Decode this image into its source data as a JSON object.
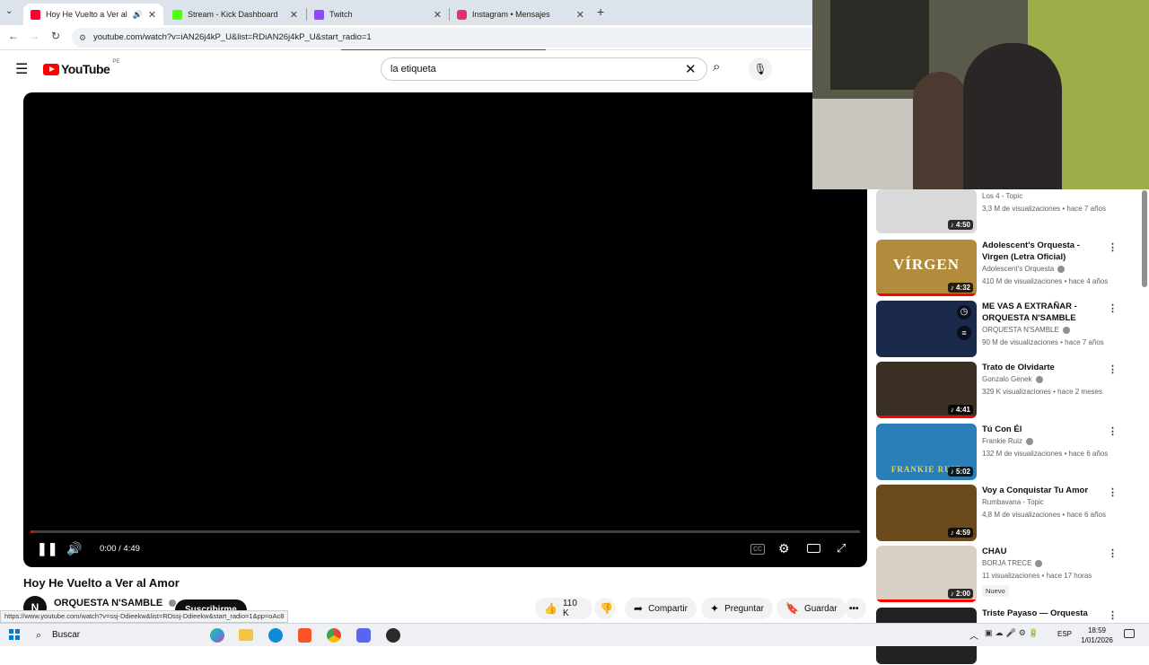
{
  "browser": {
    "tabs": [
      {
        "title": "Hoy He Vuelto a Ver al Amor",
        "color": "#ff0033",
        "active": true
      },
      {
        "title": "Stream - Kick Dashboard",
        "color": "#53fc18",
        "active": false
      },
      {
        "title": "Twitch",
        "color": "#9146ff",
        "active": false
      },
      {
        "title": "Instagram • Mensajes",
        "color": "#e1306c",
        "active": false
      }
    ],
    "url": "youtube.com/watch?v=iAN26j4kP_U&list=RDiAN26j4kP_U&start_radio=1",
    "status_url": "https://www.youtube.com/watch?v=ssj-Ddieekw&list=RDssj-Ddieekw&start_radio=1&pp=oAc8"
  },
  "youtube": {
    "logo_text": "YouTube",
    "region": "PE",
    "search_query": "la etiqueta"
  },
  "player": {
    "time": "0:00 / 4:49",
    "progress": 0.003
  },
  "video": {
    "title": "Hoy He Vuelto a Ver al Amor",
    "channel": "ORQUESTA N'SAMBLE",
    "subscribe_label": "Suscribirme",
    "likes": "110 K",
    "share_label": "Compartir",
    "ask_label": "Preguntar",
    "save_label": "Guardar"
  },
  "recommendations": [
    {
      "title": "",
      "channel": "Los 4 - Topic",
      "meta": "3,3 M de visualizaciones • hace 7 años",
      "duration": "4:50",
      "thumb_color": "#d9d9d9",
      "verified": false
    },
    {
      "title": "Adolescent's Orquesta - Virgen (Letra Oficial)",
      "channel": "Adolescent's Orquesta",
      "meta": "410 M de visualizaciones • hace 4 años",
      "duration": "4:32",
      "thumb_color": "#b38b3c",
      "thumb_text": "VÍRGEN",
      "verified": true
    },
    {
      "title": "ME VAS A EXTRAÑAR - ORQUESTA N'SAMBLE",
      "channel": "ORQUESTA N'SAMBLE",
      "meta": "90 M de visualizaciones • hace 7 años",
      "duration": "",
      "thumb_color": "#1b2a4a",
      "verified": true
    },
    {
      "title": "Trato de Olvidarte",
      "channel": "Gonzalo Genek",
      "meta": "329 K visualizaciones • hace 2 meses",
      "duration": "4:41",
      "thumb_color": "#3a3024",
      "verified": true
    },
    {
      "title": "Tú Con Él",
      "channel": "Frankie Ruiz",
      "meta": "132 M de visualizaciones • hace 6 años",
      "duration": "5:02",
      "thumb_color": "#2a7fb8",
      "thumb_text": "FRANKIE RUIZ",
      "verified": true
    },
    {
      "title": "Voy a Conquistar Tu Amor",
      "channel": "Rumbavana - Topic",
      "meta": "4,8 M de visualizaciones • hace 6 años",
      "duration": "4:59",
      "thumb_color": "#6b4a1e",
      "verified": false
    },
    {
      "title": "CHAU",
      "channel": "BORJA TRECE",
      "meta": "11 visualizaciones • hace 17 horas",
      "badge": "Nuevo",
      "duration": "2:00",
      "thumb_color": "#d8d0c4",
      "verified": true
    },
    {
      "title": "Triste Payaso — Orquesta",
      "channel": "",
      "meta": "",
      "duration": "",
      "thumb_color": "#222222",
      "verified": false
    }
  ],
  "taskbar": {
    "search_placeholder": "Buscar",
    "language": "ESP",
    "time": "18:59",
    "date": "1/01/2026"
  }
}
